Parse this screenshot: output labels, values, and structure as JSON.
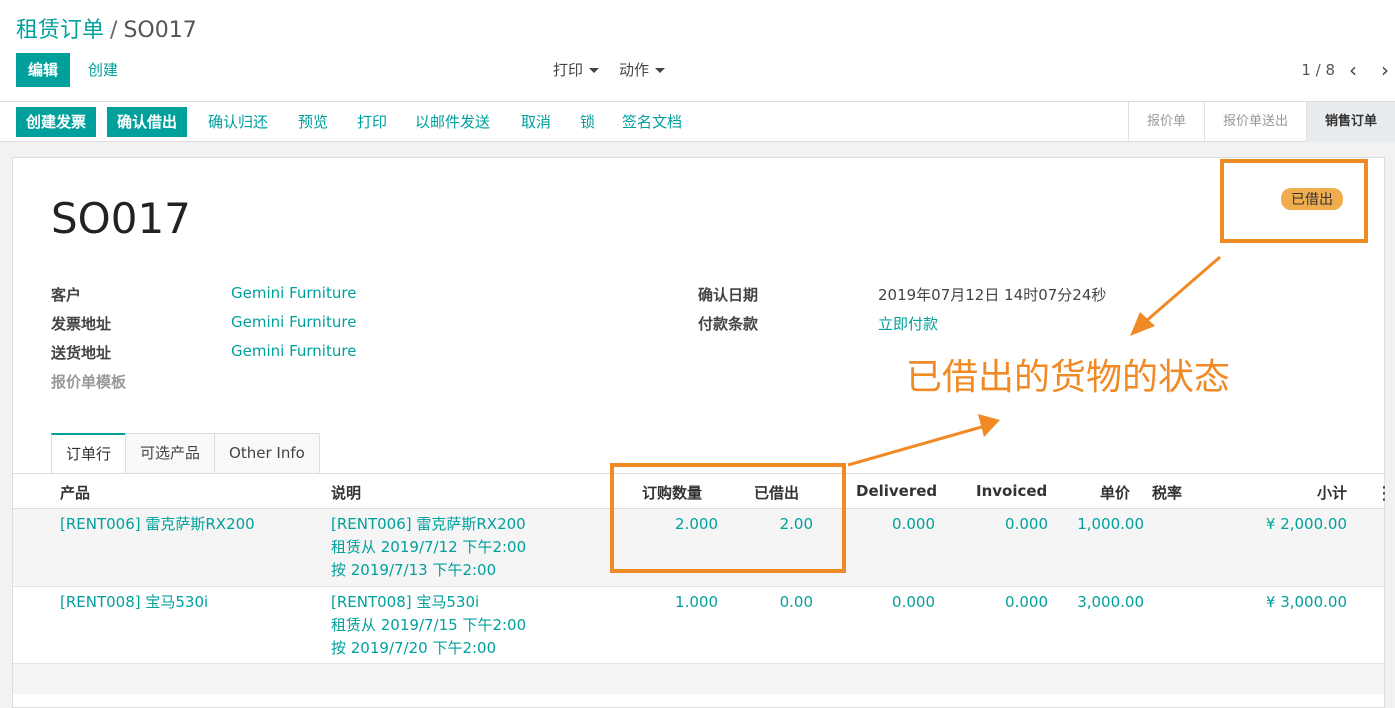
{
  "breadcrumb": {
    "parent": "租赁订单",
    "separator": "/",
    "current": "SO017"
  },
  "toolbar": {
    "edit_label": "编辑",
    "create_label": "创建",
    "print_label": "打印",
    "action_label": "动作",
    "pager": "1 / 8"
  },
  "statusbar": {
    "buttons": [
      "创建发票",
      "确认借出",
      "确认归还",
      "预览",
      "打印",
      "以邮件发送",
      "取消",
      "锁",
      "签名文档"
    ],
    "stages": [
      "报价单",
      "报价单送出",
      "销售订单"
    ]
  },
  "form": {
    "title": "SO017",
    "state_badge": "已借出",
    "fields_left": [
      {
        "label": "客户",
        "value": "Gemini Furniture"
      },
      {
        "label": "发票地址",
        "value": "Gemini Furniture"
      },
      {
        "label": "送货地址",
        "value": "Gemini Furniture"
      },
      {
        "label": "报价单模板",
        "value": ""
      }
    ],
    "fields_right": [
      {
        "label": "确认日期",
        "value": "2019年07月12日 14时07分24秒"
      },
      {
        "label": "付款条款",
        "value": "立即付款"
      }
    ]
  },
  "tabs": [
    "订单行",
    "可选产品",
    "Other Info"
  ],
  "table": {
    "headers": [
      "产品",
      "说明",
      "订购数量",
      "已借出",
      "Delivered",
      "Invoiced",
      "单价",
      "税率",
      "小计"
    ],
    "rows": [
      {
        "product": "[RENT006] 雷克萨斯RX200",
        "desc1": "[RENT006] 雷克萨斯RX200",
        "desc2": "租赁从 2019/7/12 下午2:00",
        "desc3": "按 2019/7/13 下午2:00",
        "qty": "2.000",
        "lent": "2.00",
        "delivered": "0.000",
        "invoiced": "0.000",
        "price": "1,000.00",
        "subtotal": "¥ 2,000.00"
      },
      {
        "product": "[RENT008] 宝马530i",
        "desc1": "[RENT008] 宝马530i",
        "desc2": "租赁从 2019/7/15 下午2:00",
        "desc3": "按 2019/7/20 下午2:00",
        "qty": "1.000",
        "lent": "0.00",
        "delivered": "0.000",
        "invoiced": "0.000",
        "price": "3,000.00",
        "subtotal": "¥ 3,000.00"
      }
    ]
  },
  "annotation": {
    "text": "已借出的货物的状态",
    "color": "#f08a24"
  },
  "colors": {
    "accent": "#00a09d",
    "badge": "#f0ad4e",
    "annotation": "#f08a24"
  }
}
